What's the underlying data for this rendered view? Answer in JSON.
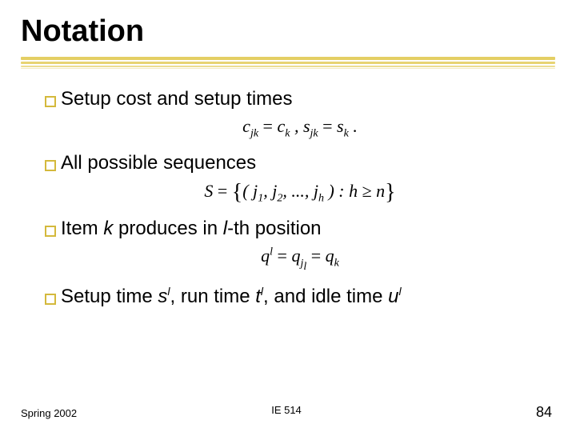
{
  "title": "Notation",
  "bullets": {
    "b1": "Setup cost and setup times",
    "b2": "All possible sequences",
    "b3_pre": "Item ",
    "b3_k": "k",
    "b3_mid": " produces in ",
    "b3_l": "l",
    "b3_post": "-th position",
    "b4_pre": "Setup time ",
    "b4_s": "s",
    "b4_sl": "l",
    "b4_mid1": ", run time ",
    "b4_t": "t",
    "b4_tl": "l",
    "b4_mid2": ", and idle time ",
    "b4_u": "u",
    "b4_ul": "l"
  },
  "formulas": {
    "f1_html": "c<sub>jk</sub> <span class='up'>=</span> c<sub>k</sub> ,  s<sub>jk</sub> <span class='up'>=</span> s<sub>k</sub> .",
    "f2_html": "S <span class='up'>=</span> <span class='brace'>{</span>( j<sub>1</sub>, j<sub>2</sub>, ..., j<sub>h</sub> ) : h <span class='up'>≥</span> n<span class='brace'>}</span>",
    "f3_html": "q<sup>l</sup> <span class='up'>=</span> q<sub>j<sub>l</sub></sub> <span class='up'>=</span> q<sub>k</sub>"
  },
  "footer": {
    "left": "Spring 2002",
    "center": "IE 514",
    "right": "84"
  }
}
